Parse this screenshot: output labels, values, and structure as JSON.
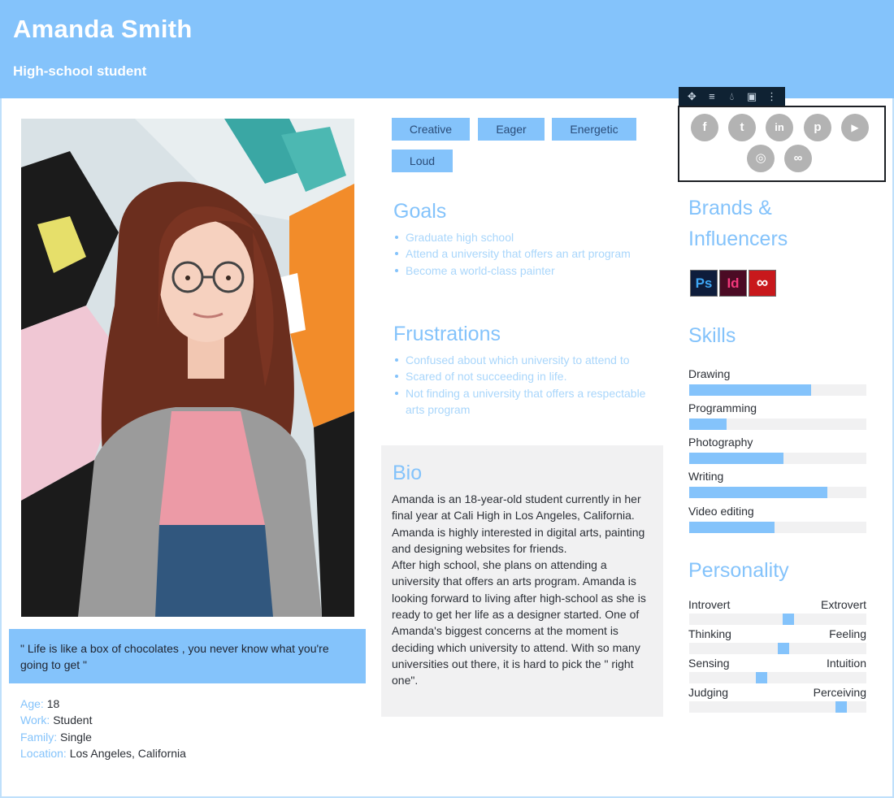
{
  "persona": {
    "name": "Amanda Smith",
    "role": "High-school student"
  },
  "quote": "\" Life is like a box of chocolates , you never know what you're going to get \"",
  "details": [
    {
      "key": "Age:",
      "value": " 18"
    },
    {
      "key": "Work:",
      "value": " Student"
    },
    {
      "key": "Family:",
      "value": " Single"
    },
    {
      "key": "Location:",
      "value": " Los Angeles, California"
    }
  ],
  "traits": [
    "Creative",
    "Eager",
    "Energetic",
    "Loud"
  ],
  "goals": {
    "title": "Goals",
    "items": [
      "Graduate high school",
      "Attend a university that offers an art program",
      "Become a world-class painter"
    ]
  },
  "frustrations": {
    "title": "Frustrations",
    "items": [
      "Confused about which university to attend to",
      "Scared of not succeeding in life.",
      "Not finding a university that offers a respectable arts program"
    ]
  },
  "bio": {
    "title": "Bio",
    "text": "Amanda is an 18-year-old student currently in her final year at Cali High in Los Angeles, California. Amanda is highly interested in digital arts, painting and designing websites for friends.\nAfter high school, she plans on attending a university that offers an arts program. Amanda is looking forward to living after high-school as she is ready to get her life as a designer started. One of Amanda's biggest concerns at the moment is deciding which university to attend. With so many universities out there, it is hard to pick the \" right one\"."
  },
  "toolbar": {
    "icons": [
      "move-icon",
      "align-icon",
      "color-drop-icon",
      "image-icon",
      "more-vertical-icon"
    ]
  },
  "social": {
    "icons": [
      "facebook-icon",
      "twitter-icon",
      "linkedin-icon",
      "pinterest-icon",
      "youtube-icon",
      "instagram-icon",
      "link-icon"
    ],
    "glyphs": [
      "f",
      "t",
      "in",
      "p",
      "▶",
      "◎",
      "∞"
    ]
  },
  "brands": {
    "title_line1": "Brands &",
    "title_line2": "Influencers",
    "logos": [
      {
        "icon": "photoshop-icon",
        "text": "Ps",
        "bg": "#0e1d3b",
        "fg": "#3ea7f5"
      },
      {
        "icon": "indesign-icon",
        "text": "Id",
        "bg": "#4b0b24",
        "fg": "#f3387c"
      },
      {
        "icon": "creative-cloud-icon",
        "text": "∞",
        "bg": "#c8181c",
        "fg": "#ffffff"
      }
    ]
  },
  "skills": {
    "title": "Skills",
    "items": [
      {
        "label": "Drawing",
        "level": 0.69
      },
      {
        "label": "Programming",
        "level": 0.21
      },
      {
        "label": "Photography",
        "level": 0.53
      },
      {
        "label": "Writing",
        "level": 0.78
      },
      {
        "label": "Video editing",
        "level": 0.48
      }
    ]
  },
  "personality": {
    "title": "Personality",
    "items": [
      {
        "left": "Introvert",
        "right": "Extrovert",
        "position": 0.56
      },
      {
        "left": "Thinking",
        "right": "Feeling",
        "position": 0.53
      },
      {
        "left": "Sensing",
        "right": "Intuition",
        "position": 0.41
      },
      {
        "left": "Judging",
        "right": "Perceiving",
        "position": 0.86
      }
    ]
  },
  "colors": {
    "accent": "#84c3fb",
    "panel": "#f1f1f2",
    "social_gray": "#b3b3b3"
  }
}
